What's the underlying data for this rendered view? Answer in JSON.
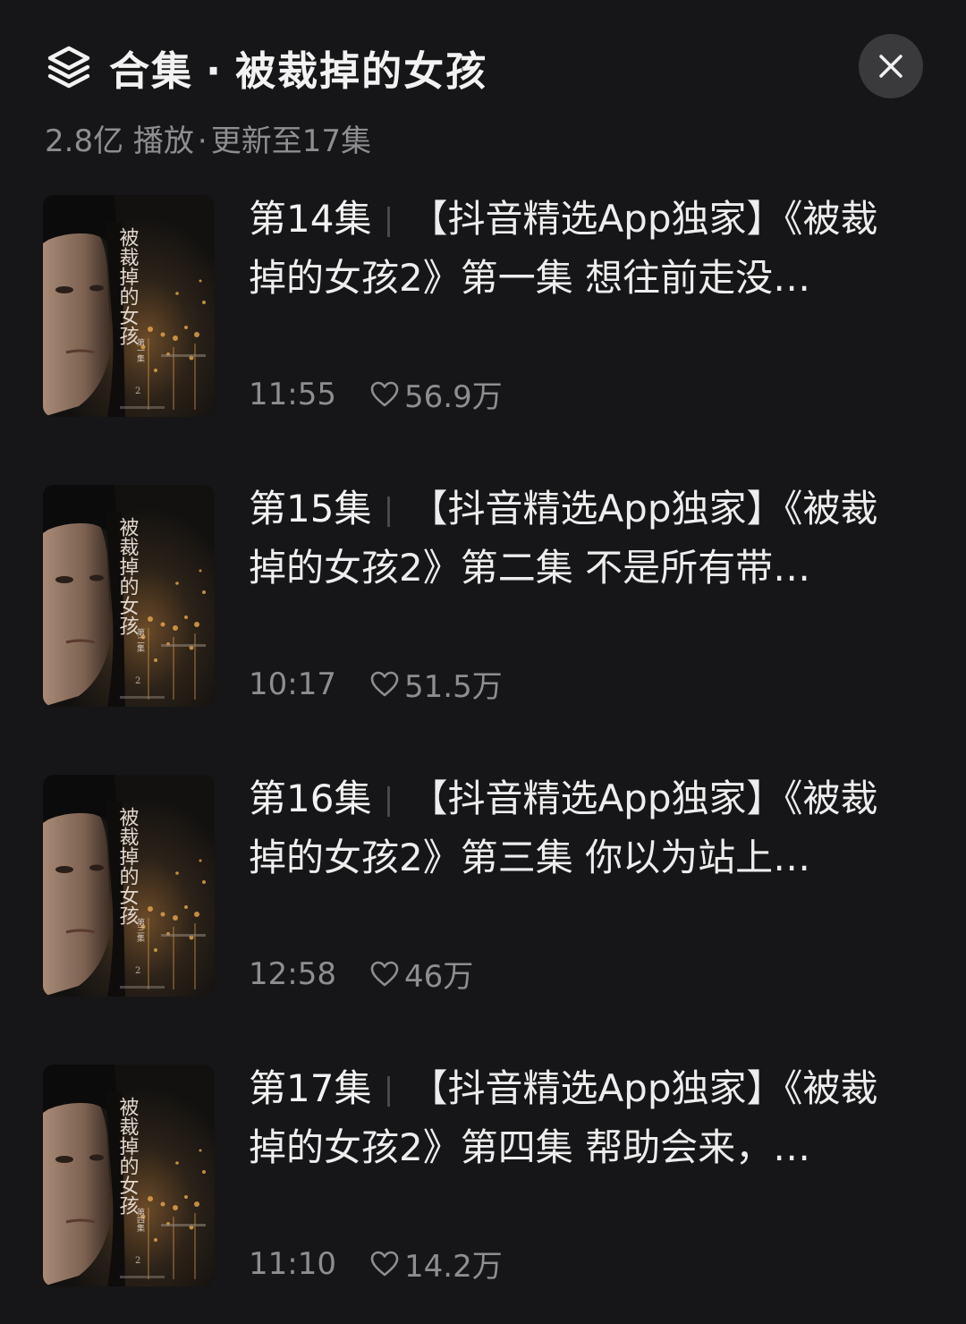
{
  "header": {
    "icon": "layers-icon",
    "label": "合集",
    "dot": "·",
    "series_name": "被裁掉的女孩"
  },
  "stats": {
    "plays": "2.8亿 播放",
    "sep": "·",
    "update": "更新至17集"
  },
  "close_icon": "close-icon",
  "colors": {
    "background": "#161618",
    "close_button_bg": "#3a3a3d",
    "secondary_text": "#8e8e90"
  },
  "episodes": [
    {
      "number": "第14集",
      "title": "【抖音精选App独家】《被裁掉的女孩2》第一集 想往前走没…",
      "duration": "11:55",
      "likes": "56.9万",
      "poster_title": "被裁掉的女孩",
      "poster_sub": "第一集"
    },
    {
      "number": "第15集",
      "title": "【抖音精选App独家】《被裁掉的女孩2》第二集 不是所有带…",
      "duration": "10:17",
      "likes": "51.5万",
      "poster_title": "被裁掉的女孩",
      "poster_sub": "第二集"
    },
    {
      "number": "第16集",
      "title": "【抖音精选App独家】《被裁掉的女孩2》第三集 你以为站上…",
      "duration": "12:58",
      "likes": "46万",
      "poster_title": "被裁掉的女孩",
      "poster_sub": "第三集"
    },
    {
      "number": "第17集",
      "title": "【抖音精选App独家】《被裁掉的女孩2》第四集 帮助会来，…",
      "duration": "11:10",
      "likes": "14.2万",
      "poster_title": "被裁掉的女孩",
      "poster_sub": "第四集"
    }
  ]
}
